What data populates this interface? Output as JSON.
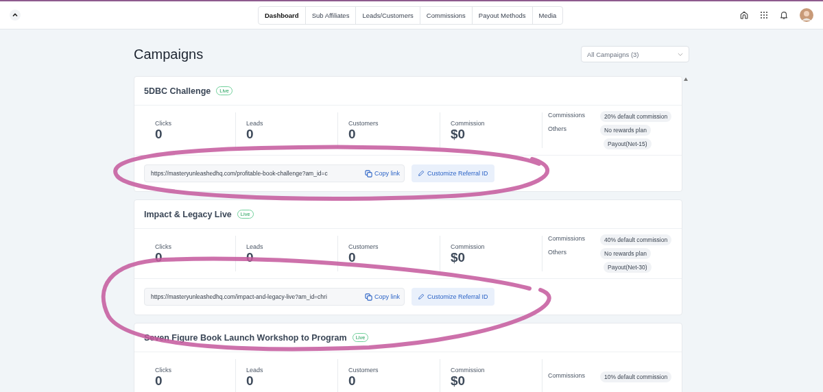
{
  "nav": {
    "tabs": [
      {
        "label": "Dashboard",
        "selected": true
      },
      {
        "label": "Sub Affiliates",
        "selected": false
      },
      {
        "label": "Leads/Customers",
        "selected": false
      },
      {
        "label": "Commissions",
        "selected": false
      },
      {
        "label": "Payout Methods",
        "selected": false
      },
      {
        "label": "Media",
        "selected": false
      }
    ]
  },
  "page_title": "Campaigns",
  "filter": {
    "value": "All Campaigns (3)"
  },
  "campaigns": [
    {
      "name": "5DBC Challenge",
      "status": "Live",
      "circled": true,
      "stats": [
        {
          "label": "Clicks",
          "value": "0"
        },
        {
          "label": "Leads",
          "value": "0"
        },
        {
          "label": "Customers",
          "value": "0"
        },
        {
          "label": "Commission",
          "value": "$0"
        }
      ],
      "commissions_label": "Commissions",
      "commission_tags": [
        "20% default commission"
      ],
      "others_label": "Others",
      "other_tags": [
        "No rewards plan",
        "Payout(Net-15)"
      ],
      "link": "https://masteryunleashedhq.com/profitable-book-challenge?am_id=c",
      "copy_label": "Copy link",
      "customize_label": "Customize Referral ID"
    },
    {
      "name": "Impact & Legacy Live",
      "status": "Live",
      "circled": true,
      "stats": [
        {
          "label": "Clicks",
          "value": "0"
        },
        {
          "label": "Leads",
          "value": "0"
        },
        {
          "label": "Customers",
          "value": "0"
        },
        {
          "label": "Commission",
          "value": "$0"
        }
      ],
      "commissions_label": "Commissions",
      "commission_tags": [
        "40% default commission"
      ],
      "others_label": "Others",
      "other_tags": [
        "No rewards plan",
        "Payout(Net-30)"
      ],
      "link": "https://masteryunleashedhq.com/impact-and-legacy-live?am_id=chri",
      "copy_label": "Copy link",
      "customize_label": "Customize Referral ID"
    },
    {
      "name": "Seven Figure Book Launch Workshop to Program",
      "status": "Live",
      "circled": false,
      "stats": [
        {
          "label": "Clicks",
          "value": "0"
        },
        {
          "label": "Leads",
          "value": "0"
        },
        {
          "label": "Customers",
          "value": "0"
        },
        {
          "label": "Commission",
          "value": "$0"
        }
      ],
      "commissions_label": "Commissions",
      "commission_tags": [
        "10% default commission"
      ]
    }
  ]
}
